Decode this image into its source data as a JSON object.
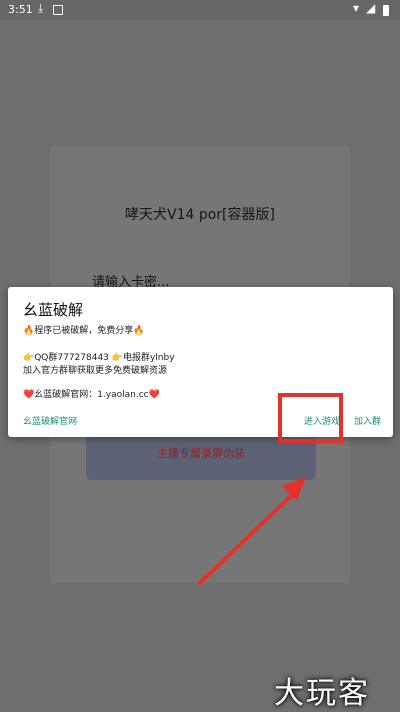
{
  "status_bar": {
    "time": "3:51"
  },
  "background_screen": {
    "title": "哮天犬V14 por[容器版]",
    "prompt": "请输入卡密...",
    "button_label": "主播专属录屏伪装"
  },
  "dialog": {
    "title": "幺蓝破解",
    "line1": "🔥程序已被破解，免费分享🔥",
    "line2": "👉QQ群777278443 👉电报群ylnby",
    "line3": "加入官方群聊获取更多免费破解资源",
    "line4": "❤️幺蓝破解官网：1.yaolan.cc❤️",
    "left_action": "幺蓝破解官网",
    "enter_action": "进入游戏",
    "join_action": "加入群"
  },
  "annotation": {
    "color": "#e5302a"
  },
  "watermark": "大玩客"
}
